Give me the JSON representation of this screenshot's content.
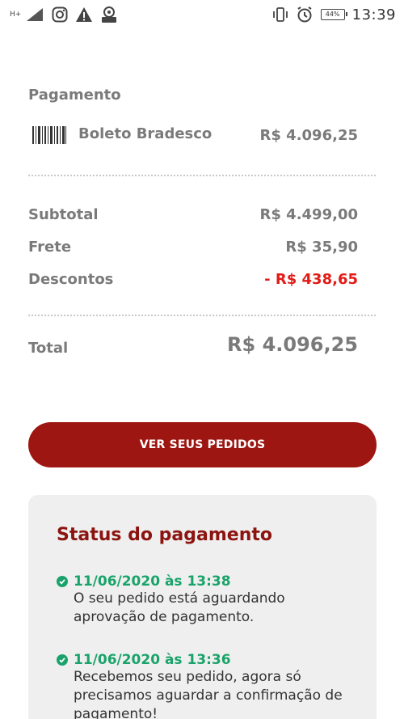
{
  "status_bar": {
    "network": "H+",
    "battery": "44%",
    "time": "13:39"
  },
  "payment": {
    "section_label": "Pagamento",
    "method": "Boleto Bradesco",
    "amount": "R$ 4.096,25"
  },
  "summary": {
    "subtotal_label": "Subtotal",
    "subtotal_value": "R$ 4.499,00",
    "frete_label": "Frete",
    "frete_value": "R$ 35,90",
    "descontos_label": "Descontos",
    "descontos_value": "- R$ 438,65",
    "total_label": "Total",
    "total_value": "R$ 4.096,25"
  },
  "cta": {
    "label": "VER SEUS PEDIDOS"
  },
  "status": {
    "title": "Status do pagamento",
    "entries": [
      {
        "datetime": "11/06/2020 às 13:38",
        "text": "O seu pedido está aguardando aprovação de pagamento."
      },
      {
        "datetime": "11/06/2020 às 13:36",
        "text": "Recebemos seu pedido, agora só precisamos aguardar a confirmação de pagamento!"
      }
    ]
  },
  "colors": {
    "accent": "#9e1612",
    "discount": "#e31b17",
    "success": "#19a36a"
  }
}
